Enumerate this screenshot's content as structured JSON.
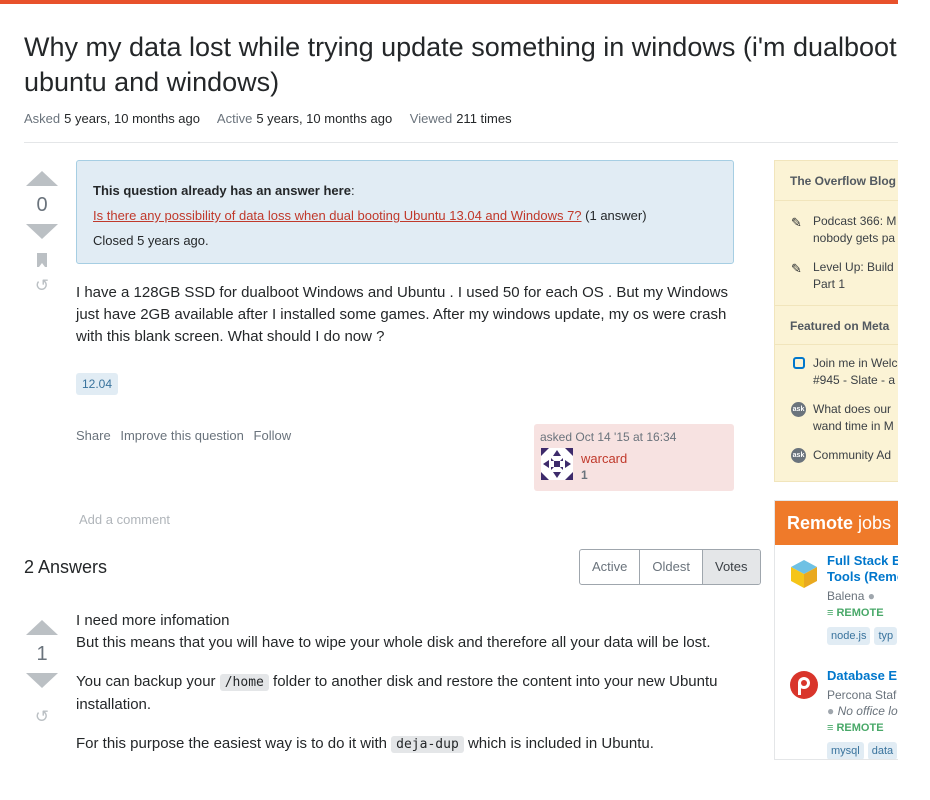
{
  "question": {
    "title": "Why my data lost while trying update something in windows (i'm dualboot ubuntu and windows)",
    "meta": {
      "asked_label": "Asked",
      "asked_value": "5 years, 10 months ago",
      "active_label": "Active",
      "active_value": "5 years, 10 months ago",
      "viewed_label": "Viewed",
      "viewed_value": "211 times"
    },
    "votes": "0",
    "notice": {
      "heading": "This question already has an answer here",
      "colon": ":",
      "link": "Is there any possibility of data loss when dual booting Ubuntu 13.04 and Windows 7?",
      "answers": "(1 answer)",
      "closed": "Closed 5 years ago."
    },
    "body": "I have a 128GB SSD for dualboot Windows and Ubuntu . I used 50 for each OS . But my Windows just have 2GB available after I installed some games. After my windows update, my os were crash with this blank screen. What should I do now ?",
    "tag": "12.04",
    "actions": {
      "share": "Share",
      "improve": "Improve this question",
      "follow": "Follow"
    },
    "owner": {
      "asked": "asked Oct 14 '15 at 16:34",
      "name": "warcard",
      "rep": "1"
    },
    "add_comment": "Add a comment"
  },
  "answers": {
    "header": "2 Answers",
    "sort": {
      "active": "Active",
      "oldest": "Oldest",
      "votes": "Votes"
    },
    "first": {
      "votes": "1",
      "line1": "I need more infomation",
      "line2": "But this means that you will have to wipe your whole disk and therefore all your data will be lost.",
      "p2_before": "You can backup your",
      "p2_code": "/home",
      "p2_after": "folder to another disk and restore the content into your new Ubuntu installation.",
      "p3_before": "For this purpose the easiest way is to do it with",
      "p3_code": "deja-dup",
      "p3_after": "which is included in Ubuntu."
    }
  },
  "sidebar": {
    "blog": {
      "title": "The Overflow Blog",
      "item1_l1": "Podcast 366: M",
      "item1_l2": "nobody gets pa",
      "item2_l1": "Level Up: Build",
      "item2_l2": "Part 1",
      "meta_title": "Featured on Meta",
      "meta1_l1": "Join me in Welc",
      "meta1_l2": "#945 - Slate - a",
      "meta2_l1": "What does our",
      "meta2_l2": "wand time in M",
      "meta3": "Community Ad"
    },
    "jobs": {
      "title_bold": "Remote",
      "title_rest": "jobs",
      "job1": {
        "t1": "Full Stack En",
        "t2": "Tools (Remo",
        "company": "Balena",
        "remote": "REMOTE",
        "tags": [
          "node.js",
          "typ"
        ]
      },
      "job2": {
        "t1": "Database En",
        "company": "Percona Staf",
        "office": "No office lo",
        "remote": "REMOTE",
        "tags": [
          "mysql",
          "data"
        ]
      }
    }
  },
  "colors": {
    "accent": "#e8512b",
    "link": "#c0392b",
    "blue": "#0077cc",
    "remote": "#48a868"
  }
}
